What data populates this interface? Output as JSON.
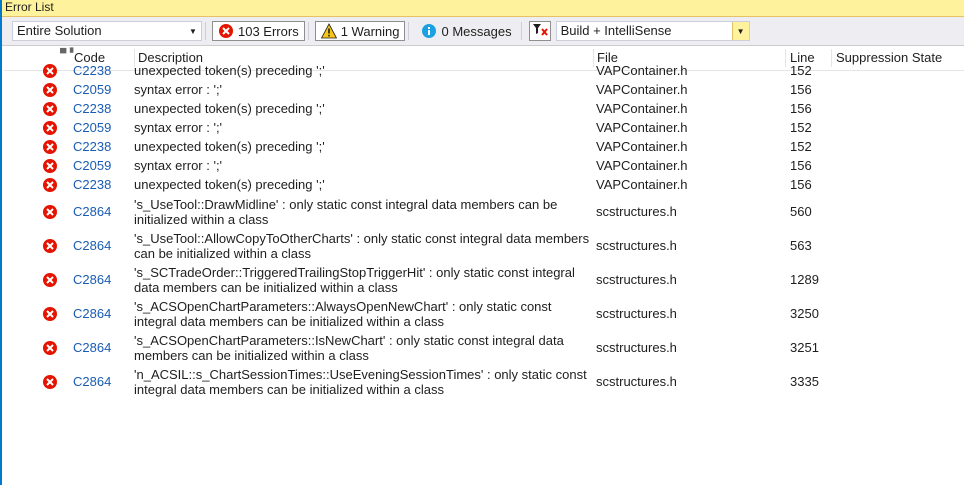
{
  "window": {
    "title": "Error List"
  },
  "toolbar": {
    "scope": "Entire Solution",
    "errors_label": "103 Errors",
    "warnings_label": "1 Warning",
    "messages_label": "0 Messages",
    "build_filter": "Build + IntelliSense"
  },
  "columns": {
    "code": "Code",
    "description": "Description",
    "file": "File",
    "line": "Line",
    "suppression": "Suppression State"
  },
  "colors": {
    "error": "#e51400",
    "warning": "#f5c518",
    "info": "#1ba1e2",
    "link": "#1a5cb4",
    "accent": "#007acc"
  },
  "rows": [
    {
      "code": "C2238",
      "description": "unexpected token(s) preceding ';'",
      "file": "VAPContainer.h",
      "line": "152"
    },
    {
      "code": "C2059",
      "description": "syntax error : ';'",
      "file": "VAPContainer.h",
      "line": "156"
    },
    {
      "code": "C2238",
      "description": "unexpected token(s) preceding ';'",
      "file": "VAPContainer.h",
      "line": "156"
    },
    {
      "code": "C2059",
      "description": "syntax error : ';'",
      "file": "VAPContainer.h",
      "line": "152"
    },
    {
      "code": "C2238",
      "description": "unexpected token(s) preceding ';'",
      "file": "VAPContainer.h",
      "line": "152"
    },
    {
      "code": "C2059",
      "description": "syntax error : ';'",
      "file": "VAPContainer.h",
      "line": "156"
    },
    {
      "code": "C2238",
      "description": "unexpected token(s) preceding ';'",
      "file": "VAPContainer.h",
      "line": "156"
    },
    {
      "code": "C2864",
      "description": "'s_UseTool::DrawMidline' : only static const integral data members can be initialized within a class",
      "file": "scstructures.h",
      "line": "560"
    },
    {
      "code": "C2864",
      "description": "'s_UseTool::AllowCopyToOtherCharts' : only static const integral data members can be initialized within a class",
      "file": "scstructures.h",
      "line": "563"
    },
    {
      "code": "C2864",
      "description": "'s_SCTradeOrder::TriggeredTrailingStopTriggerHit' : only static const integral data members can be initialized within a class",
      "file": "scstructures.h",
      "line": "1289"
    },
    {
      "code": "C2864",
      "description": "'s_ACSOpenChartParameters::AlwaysOpenNewChart' : only static const integral data members can be initialized within a class",
      "file": "scstructures.h",
      "line": "3250"
    },
    {
      "code": "C2864",
      "description": "'s_ACSOpenChartParameters::IsNewChart' : only static const integral data members can be initialized within a class",
      "file": "scstructures.h",
      "line": "3251"
    },
    {
      "code": "C2864",
      "description": "'n_ACSIL::s_ChartSessionTimes::UseEveningSessionTimes' : only static const integral data members can be initialized within a class",
      "file": "scstructures.h",
      "line": "3335"
    }
  ]
}
